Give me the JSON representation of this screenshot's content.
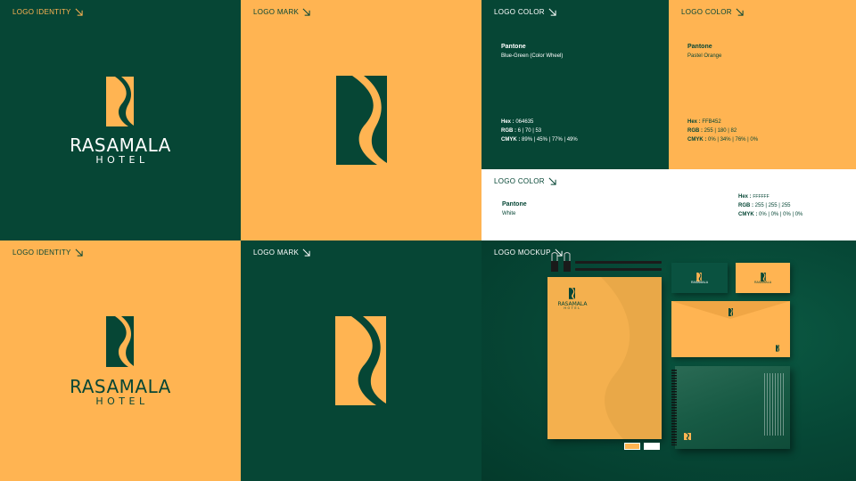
{
  "panels": {
    "identity_green": {
      "label": "LOGO IDENTITY",
      "wordmark": "RASAMALA",
      "sub": "HOTEL"
    },
    "mark_orange": {
      "label": "LOGO MARK"
    },
    "color_green": {
      "label": "LOGO COLOR",
      "pantone_title": "Pantone",
      "pantone_name": "Blue-Green (Color Wheel)",
      "hex_label": "Hex :",
      "hex": "064635",
      "rgb_label": "RGB :",
      "rgb": "6 | 70 | 53",
      "cmyk_label": "CMYK :",
      "cmyk": "89% | 45% | 77% | 49%"
    },
    "color_orange": {
      "label": "LOGO COLOR",
      "pantone_title": "Pantone",
      "pantone_name": "Pastel Orange",
      "hex_label": "Hex :",
      "hex": "FFB452",
      "rgb_label": "RGB :",
      "rgb": "255 | 180 | 82",
      "cmyk_label": "CMYK :",
      "cmyk": "0% | 34% | 76% | 0%"
    },
    "color_white": {
      "label": "LOGO COLOR",
      "pantone_title": "Pantone",
      "pantone_name": "White",
      "hex_label": "Hex :",
      "hex": "FFFFFF",
      "rgb_label": "RGB :",
      "rgb": "255 | 255 | 255",
      "cmyk_label": "CMYK :",
      "cmyk": "0% | 0% | 0% | 0%"
    },
    "identity_orange": {
      "label": "LOGO IDENTITY",
      "wordmark": "RASAMALA",
      "sub": "HOTEL"
    },
    "mark_green": {
      "label": "LOGO MARK"
    },
    "mockup": {
      "label": "LOGO MOCKUP",
      "letterhead_brand": "RASAMALA",
      "letterhead_sub": "HOTEL",
      "card_brand": "RASAMALA"
    }
  },
  "colors": {
    "green": "#064635",
    "orange": "#FFB452",
    "white": "#FFFFFF"
  },
  "icons": {
    "arrow": "arrow-down-right-icon",
    "mark": "rasamala-s-mark-icon"
  }
}
